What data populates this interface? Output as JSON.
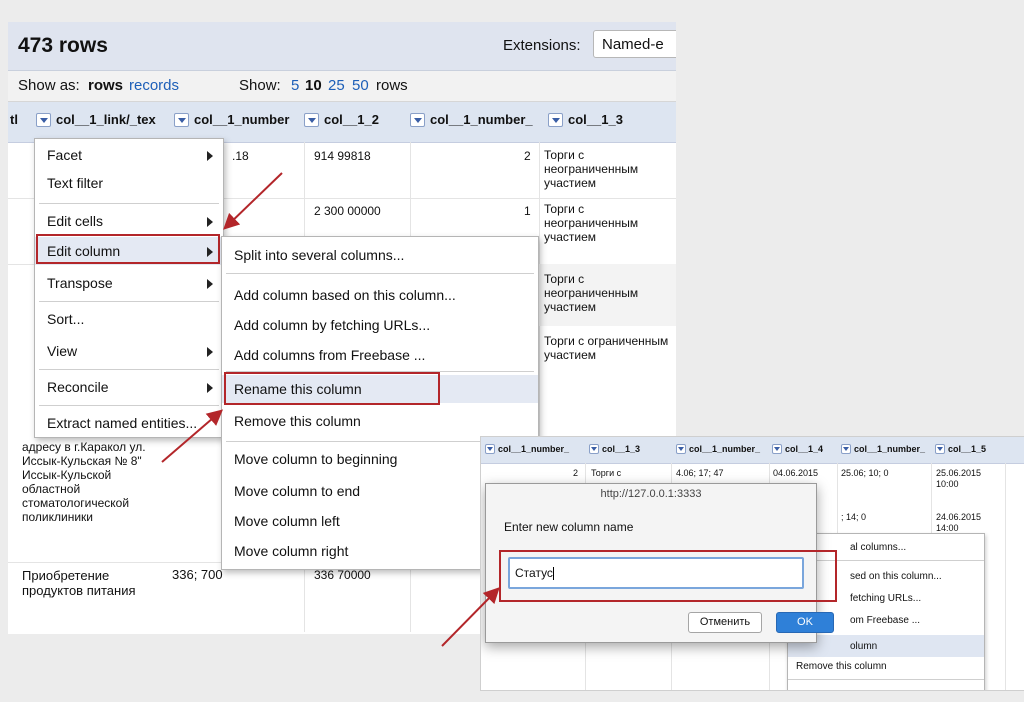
{
  "header": {
    "rows_title": "473 rows",
    "extensions_label": "Extensions:",
    "extensions_value": "Named-e"
  },
  "show_bar": {
    "show_as_label": "Show as:",
    "rows_option": "rows",
    "records_option": "records",
    "show_label": "Show:",
    "page_sizes": [
      "5",
      "10",
      "25",
      "50"
    ],
    "rows_suffix": "rows"
  },
  "columns": {
    "partial": "tl",
    "c1": "col__1_link/_tex",
    "c2": "col__1_number",
    "c3": "col__1_2",
    "c4": "col__1_number_",
    "c5": "col__1_3"
  },
  "cells": {
    "r1c2": ".18",
    "r1c3": "914 99818",
    "r1c4": "2",
    "r1c5": "Торги с неограниченным участием",
    "r2c3": "2 300 00000",
    "r2c4": "1",
    "r2c5": "Торги с неограниченным участием",
    "r3c5": "Торги с неограниченным участием",
    "r4c5": "Торги с ограниченным участием",
    "r5c1": "адресу в г.Каракол ул. Иссык-Кульская № 8\" Иссык-Кульской областной стоматологической поликлиники",
    "r6c1": "Приобретение продуктов питания",
    "r6c2": "336; 700",
    "r6c3": "336 70000"
  },
  "column_menu": {
    "facet": "Facet",
    "text_filter": "Text filter",
    "edit_cells": "Edit cells",
    "edit_column": "Edit column",
    "transpose": "Transpose",
    "sort": "Sort...",
    "view": "View",
    "reconcile": "Reconcile",
    "extract": "Extract named entities..."
  },
  "edit_column_menu": {
    "split": "Split into several columns...",
    "add_based": "Add column based on this column...",
    "add_fetch": "Add column by fetching URLs...",
    "add_freebase": "Add columns from Freebase ...",
    "rename": "Rename this column",
    "remove": "Remove this column",
    "move_begin": "Move column to beginning",
    "move_end": "Move column to end",
    "move_left": "Move column left",
    "move_right": "Move column right"
  },
  "sub": {
    "columns": [
      "col__1_number_",
      "col__1_3",
      "col__1_number_",
      "col__1_4",
      "col__1_number_",
      "col__1_5"
    ],
    "cells": {
      "a": "2",
      "b": "Торги с",
      "c": "4.06; 17; 47",
      "d": "04.06.2015",
      "e": "25.06; 10; 0",
      "f": "25.06.2015 10:00",
      "g": "; 14; 0",
      "h": "24.06.2015 14:00"
    },
    "menu": {
      "split": "al columns...",
      "add_based": "sed on this column...",
      "add_fetch": "fetching URLs...",
      "add_freebase": "om Freebase ...",
      "rename": "olumn",
      "remove": "Remove this column"
    },
    "dialog": {
      "url": "http://127.0.0.1:3333",
      "prompt": "Enter new column name",
      "value": "Статус",
      "cancel": "Отменить",
      "ok": "OK"
    }
  },
  "colors": {
    "highlight_border": "#b3262a",
    "link": "#1d5fb8",
    "header_bg": "#dde5f1",
    "ok_button": "#2f80d8"
  }
}
